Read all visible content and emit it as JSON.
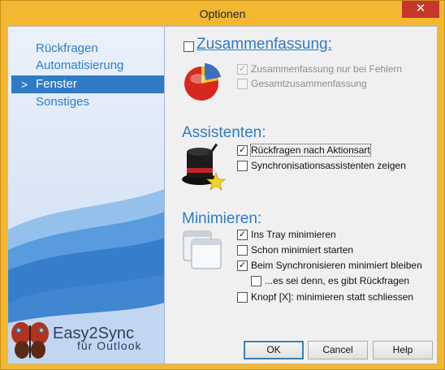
{
  "window": {
    "title": "Optionen",
    "close_glyph": "✕"
  },
  "sidebar": {
    "items": [
      {
        "label": "Rückfragen"
      },
      {
        "label": "Automatisierung"
      },
      {
        "label": "Fenster",
        "selected": true
      },
      {
        "label": "Sonstiges"
      }
    ],
    "selected_arrow": ">",
    "brand": "Easy2Sync",
    "brand_sub": "für Outlook",
    "accent_color": "#2f7bc6"
  },
  "summary": {
    "title": "Zusammenfassung:",
    "enabled": false,
    "options": [
      {
        "label": "Zusammenfassung nur bei Fehlern",
        "checked": true,
        "disabled": true
      },
      {
        "label": "Gesamtzusammenfassung",
        "checked": false,
        "disabled": true
      }
    ],
    "icon": "pie-chart-icon"
  },
  "assistants": {
    "title": "Assistenten:",
    "options": [
      {
        "label": "Rückfragen nach Aktionsart",
        "checked": true
      },
      {
        "label": "Synchronisationsassistenten zeigen",
        "checked": false
      }
    ],
    "icon": "magic-hat-icon"
  },
  "minimize": {
    "title": "Minimieren:",
    "options": [
      {
        "label": "Ins Tray minimieren",
        "checked": true
      },
      {
        "label": "Schon minimiert starten",
        "checked": false
      },
      {
        "label": "Beim Synchronisieren minimiert bleiben",
        "checked": true
      },
      {
        "label": "...es sei denn, es gibt Rückfragen",
        "checked": false
      },
      {
        "label": "Knopf [X]: minimieren statt schliessen",
        "checked": false
      }
    ],
    "icon": "windows-stack-icon"
  },
  "buttons": {
    "ok": "OK",
    "cancel": "Cancel",
    "help": "Help"
  }
}
